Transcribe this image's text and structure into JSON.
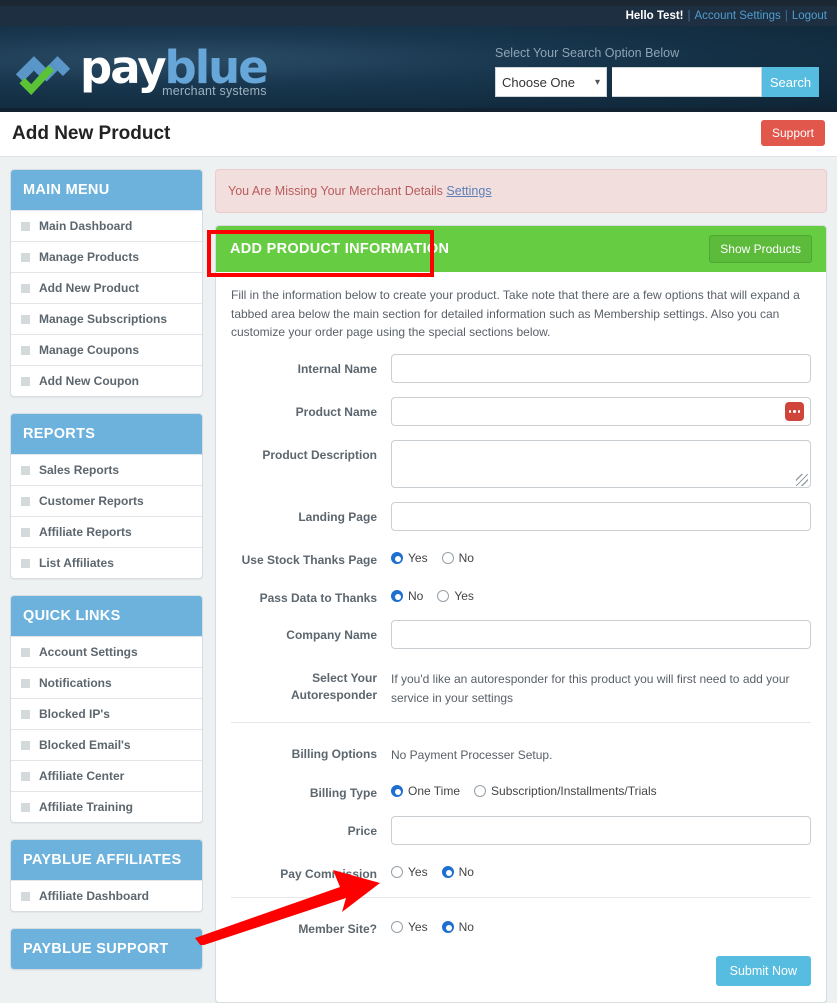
{
  "utility_bar": {
    "greeting": "Hello Test!",
    "separator": "|",
    "account_settings": "Account Settings",
    "logout": "Logout"
  },
  "brand": {
    "name_part1": "pay",
    "name_part2": "blue",
    "tagline": "merchant systems"
  },
  "search": {
    "label": "Select Your Search Option Below",
    "select_value": "Choose One",
    "input_value": "",
    "input_placeholder": "",
    "button_label": "Search"
  },
  "page": {
    "title": "Add New Product",
    "support_label": "Support"
  },
  "alert": {
    "text": "You Are Missing Your Merchant Details",
    "link": "Settings"
  },
  "sidebar": {
    "panels": [
      {
        "heading": "MAIN MENU",
        "items": [
          "Main Dashboard",
          "Manage Products",
          "Add New Product",
          "Manage Subscriptions",
          "Manage Coupons",
          "Add New Coupon"
        ]
      },
      {
        "heading": "REPORTS",
        "items": [
          "Sales Reports",
          "Customer Reports",
          "Affiliate Reports",
          "List Affiliates"
        ]
      },
      {
        "heading": "QUICK LINKS",
        "items": [
          "Account Settings",
          "Notifications",
          "Blocked IP's",
          "Blocked Email's",
          "Affiliate Center",
          "Affiliate Training"
        ]
      },
      {
        "heading": "PAYBLUE AFFILIATES",
        "items": [
          "Affiliate Dashboard"
        ]
      },
      {
        "heading": "PAYBLUE SUPPORT",
        "items": []
      }
    ]
  },
  "main": {
    "section_title": "ADD PRODUCT INFORMATION",
    "show_products_label": "Show Products",
    "intro": "Fill in the information below to create your product. Take note that there are a few options that will expand a tabbed area below the main section for detailed information such as Membership settings. Also you can customize your order page using the special sections below.",
    "fields": {
      "internal_name": {
        "label": "Internal Name",
        "value": "",
        "placeholder": ""
      },
      "product_name": {
        "label": "Product Name",
        "value": "",
        "placeholder": ""
      },
      "product_description": {
        "label": "Product Description",
        "value": "",
        "placeholder": ""
      },
      "landing_page": {
        "label": "Landing Page",
        "value": "",
        "placeholder": ""
      },
      "use_stock_thanks_page": {
        "label": "Use Stock Thanks Page",
        "options": [
          "Yes",
          "No"
        ],
        "selected": "Yes"
      },
      "pass_data_to_thanks": {
        "label": "Pass Data to Thanks",
        "options": [
          "No",
          "Yes"
        ],
        "selected": "No"
      },
      "company_name": {
        "label": "Company Name",
        "value": "",
        "placeholder": ""
      },
      "autoresponder": {
        "label": "Select Your Autoresponder",
        "note": "If you'd like an autoresponder for this product you will first need to add your service in your settings"
      },
      "billing_options": {
        "label": "Billing Options",
        "note": "No Payment Processer Setup."
      },
      "billing_type": {
        "label": "Billing Type",
        "options": [
          "One Time",
          "Subscription/Installments/Trials"
        ],
        "selected": "One Time"
      },
      "price": {
        "label": "Price",
        "value": "",
        "placeholder": ""
      },
      "pay_commission": {
        "label": "Pay Commission",
        "options": [
          "Yes",
          "No"
        ],
        "selected": "No"
      },
      "member_site": {
        "label": "Member Site?",
        "options": [
          "Yes",
          "No"
        ],
        "selected": "No"
      }
    },
    "submit_label": "Submit Now"
  },
  "icons": {
    "password_manager": "password-manager-badge-icon",
    "resize": "textarea-resize-grip-icon",
    "caret": "chevron-down-icon"
  },
  "annotations": {
    "highlight_box_color": "#ff0000",
    "arrow_color": "#ff0000",
    "arrow_target": "member_site_yes_radio"
  },
  "colors": {
    "brand_blue": "#66a6d8",
    "panel_header_blue": "#6cb2dd",
    "section_green": "#66cc41",
    "support_red": "#e1574c",
    "submit_blue": "#57bde0",
    "alert_bg": "#f3dede",
    "alert_text": "#b85c5c"
  }
}
